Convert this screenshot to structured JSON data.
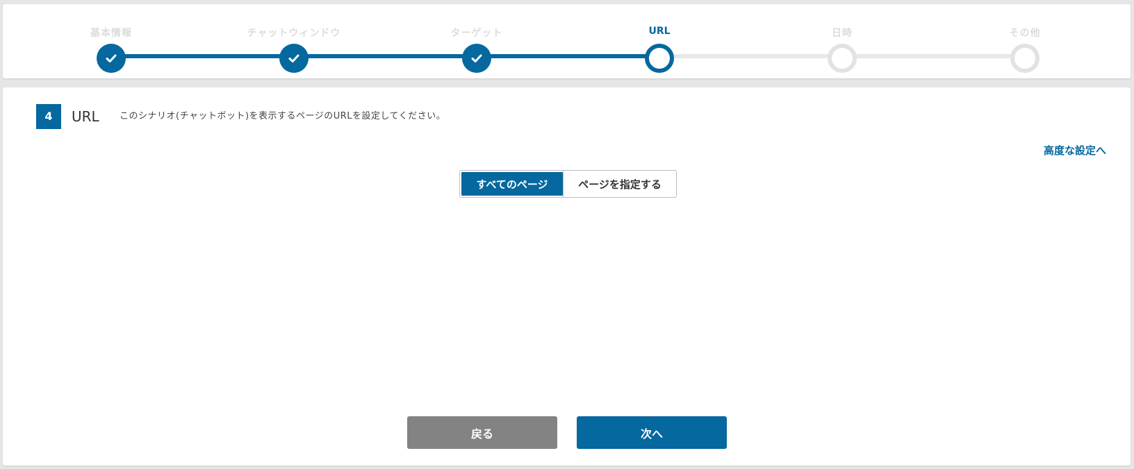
{
  "stepper": {
    "steps": [
      {
        "label": "基本情報",
        "status": "done"
      },
      {
        "label": "チャットウィンドウ",
        "status": "done"
      },
      {
        "label": "ターゲット",
        "status": "done"
      },
      {
        "label": "URL",
        "status": "current"
      },
      {
        "label": "日時",
        "status": "todo"
      },
      {
        "label": "その他",
        "status": "todo"
      }
    ]
  },
  "section": {
    "number": "4",
    "title": "URL",
    "description": "このシナリオ(チャットボット)を表示するページのURLを設定してください。",
    "advanced_link": "高度な設定へ"
  },
  "url_mode": {
    "options": [
      "すべてのページ",
      "ページを指定する"
    ],
    "selected": "すべてのページ"
  },
  "footer": {
    "back_label": "戻る",
    "next_label": "次へ"
  },
  "colors": {
    "accent": "#05689f",
    "inactive": "#e2e2e2",
    "back_button": "#838383"
  }
}
